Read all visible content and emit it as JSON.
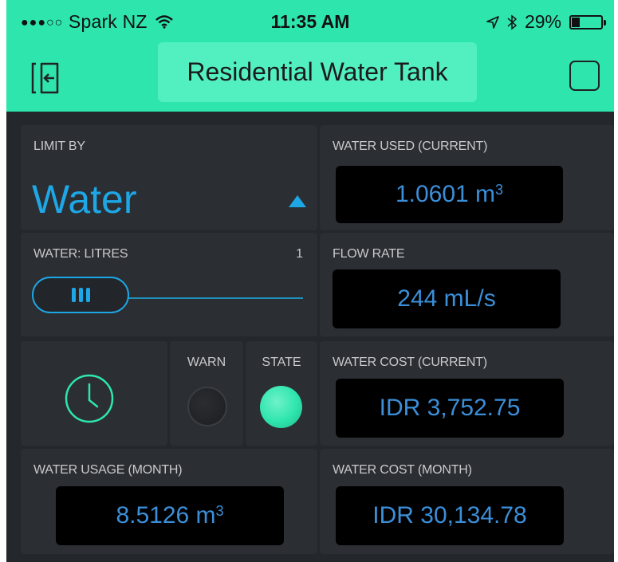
{
  "status_bar": {
    "signal_dots": "●●●○○",
    "carrier": "Spark NZ",
    "time": "11:35 AM",
    "battery": "29%",
    "battery_level": 0.29
  },
  "header": {
    "title": "Residential Water Tank"
  },
  "widgets": {
    "limit_by": {
      "label": "LIMIT BY",
      "value": "Water"
    },
    "water_used_current": {
      "label": "WATER USED (CURRENT)",
      "value": "1.0601 m",
      "unit_sup": "3"
    },
    "water_litres": {
      "label": "WATER: LITRES",
      "max": "1"
    },
    "flow_rate": {
      "label": "FLOW RATE",
      "value": "244 mL/s"
    },
    "warn": {
      "label": "WARN"
    },
    "state": {
      "label": "STATE"
    },
    "water_cost_current": {
      "label": "WATER COST (CURRENT)",
      "value": "IDR 3,752.75"
    },
    "water_usage_month": {
      "label": "WATER USAGE (MONTH)",
      "value": "8.5126 m",
      "unit_sup": "3"
    },
    "water_cost_month": {
      "label": "WATER COST (MONTH)",
      "value": "IDR 30,134.78"
    }
  },
  "icons": [
    "wifi-icon",
    "location-arrow-icon",
    "bluetooth-icon",
    "battery-icon",
    "exit-icon",
    "stop-icon",
    "dropdown-arrow-icon",
    "slider-grip-icon",
    "clock-icon"
  ],
  "colors": {
    "accent_green": "#2ee5ae",
    "title_box": "#52f0c1",
    "value_blue": "#3b8fd9",
    "dropdown_blue": "#1ea7e6",
    "tile_bg": "#2b2e33",
    "app_bg": "#24272c"
  }
}
